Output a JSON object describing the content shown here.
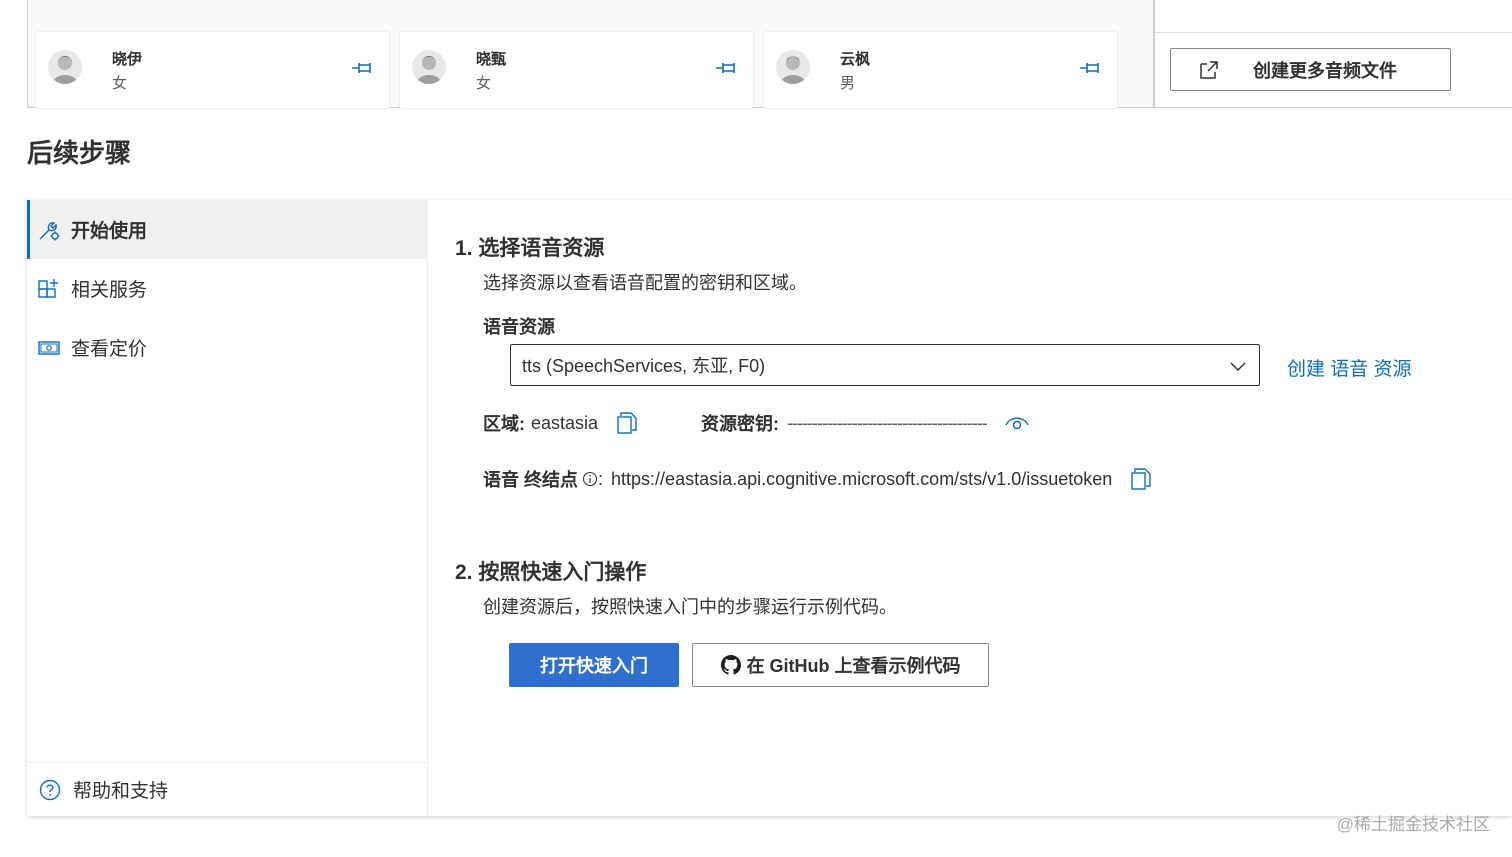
{
  "voices": [
    {
      "name": "晓伊",
      "gender": "女"
    },
    {
      "name": "晓甄",
      "gender": "女"
    },
    {
      "name": "云枫",
      "gender": "男"
    }
  ],
  "create_audio": {
    "label": "创建更多音频文件"
  },
  "section_title": "后续步骤",
  "sidebar": {
    "items": [
      {
        "label": "开始使用",
        "icon": "wrench-gear-icon",
        "active": true
      },
      {
        "label": "相关服务",
        "icon": "grid-add-icon",
        "active": false
      },
      {
        "label": "查看定价",
        "icon": "money-icon",
        "active": false
      }
    ],
    "footer": {
      "label": "帮助和支持",
      "icon": "help-circle-icon"
    }
  },
  "step1": {
    "title": "1. 选择语音资源",
    "desc": "选择资源以查看语音配置的密钥和区域。",
    "field_label": "语音资源",
    "dropdown_value": "tts (SpeechServices, 东亚, F0)",
    "create_link": "创建 语音 资源",
    "region_label": "区域:",
    "region_value": "eastasia",
    "key_label": "资源密钥:",
    "key_value": "----------------------------------------",
    "endpoint_label": "语音 终结点",
    "endpoint_value": "https://eastasia.api.cognitive.microsoft.com/sts/v1.0/issuetoken"
  },
  "step2": {
    "title": "2. 按照快速入门操作",
    "desc": "创建资源后，按照快速入门中的步骤运行示例代码。",
    "primary_btn": "打开快速入门",
    "secondary_btn": "在 GitHub 上查看示例代码"
  },
  "watermark": "@稀土掘金技术社区",
  "colors": {
    "accent": "#0f6cbd",
    "primary_button": "#2f6fd0"
  }
}
